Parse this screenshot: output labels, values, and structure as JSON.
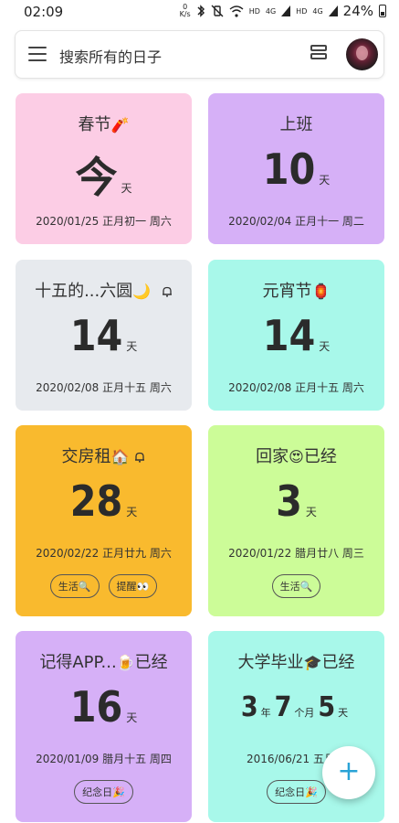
{
  "status_bar": {
    "time": "02:09",
    "speed_value": "0",
    "speed_unit": "K/s",
    "bluetooth_icon": "bluetooth-icon",
    "mute_icon": "vibrate-off-icon",
    "wifi_icon": "wifi-icon",
    "hd1": "HD",
    "net1": "4G",
    "hd2": "HD",
    "net2": "4G",
    "battery_pct": "24%"
  },
  "search": {
    "placeholder": "搜索所有的日子"
  },
  "cards": [
    {
      "title": "春节",
      "emoji": "🧨",
      "number": "今",
      "unit": "天",
      "date": "2020/01/25 正月初一 周六",
      "color": "#fccde5"
    },
    {
      "title": "上班",
      "number": "10",
      "unit": "天",
      "date": "2020/02/04 正月十一 周二",
      "color": "#d6b0f7"
    },
    {
      "title": "十五的...六圆",
      "emoji": "🌙",
      "bell": true,
      "number": "14",
      "unit": "天",
      "date": "2020/02/08 正月十五 周六",
      "color": "#e7eaee"
    },
    {
      "title": "元宵节",
      "emoji": "🏮",
      "number": "14",
      "unit": "天",
      "date": "2020/02/08 正月十五 周六",
      "color": "#a8f8ea"
    },
    {
      "title": "交房租",
      "emoji": "🏠",
      "bell": true,
      "number": "28",
      "unit": "天",
      "date": "2020/02/22 正月廿九 周六",
      "tags": [
        "生活🔍",
        "提醒👀"
      ],
      "color": "#f9ba2e"
    },
    {
      "title_pre": "回家",
      "emoji": "😍",
      "title_post": "已经",
      "number": "3",
      "unit": "天",
      "date": "2020/01/22 腊月廿八 周三",
      "tags": [
        "生活🔍"
      ],
      "color": "#ccfc98"
    },
    {
      "title_pre": "记得APP...",
      "emoji": "🍺",
      "title_post": "已经",
      "number": "16",
      "unit": "天",
      "date": "2020/01/09 腊月十五 周四",
      "tags": [
        "纪念日🎉"
      ],
      "color": "#d6b0f7"
    },
    {
      "title_pre": "大学毕业",
      "emoji": "🎓",
      "title_post": "已经",
      "years": "3",
      "year_unit": "年",
      "months": "7",
      "month_unit": "个月",
      "days": "5",
      "day_unit": "天",
      "date": "2016/06/21 五月十",
      "tags": [
        "纪念日🎉"
      ],
      "color": "#a8f8ea"
    }
  ],
  "fab": {
    "label": "+"
  }
}
